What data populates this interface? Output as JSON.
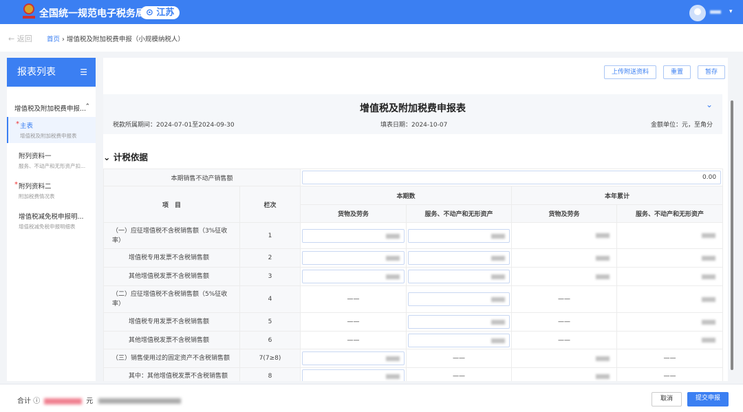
{
  "header": {
    "site_title": "全国统一规范电子税务局",
    "region": "江苏"
  },
  "breadcrumb": {
    "back": "返回",
    "home": "首页",
    "current": "增值税及附加税费申报（小规模纳税人）"
  },
  "sidebar": {
    "title": "报表列表",
    "group": "增值税及附加税费申报...",
    "items": [
      {
        "title": "主表",
        "subtitle": "增值税及附加税费申报表",
        "required": true,
        "active": true
      },
      {
        "title": "附列资料一",
        "subtitle": "服务、不动产和无形资产扣...",
        "required": false,
        "active": false
      },
      {
        "title": "附列资料二",
        "subtitle": "附加税费情况表",
        "required": true,
        "active": false
      },
      {
        "title": "增值税减免税申报明...",
        "subtitle": "增值税减免税申报明细表",
        "required": false,
        "active": false
      }
    ]
  },
  "toolbar": {
    "upload": "上传附送资料",
    "reset": "重置",
    "save": "暂存"
  },
  "form": {
    "title": "增值税及附加税费申报表",
    "period": "税款所属期间：2024-07-01至2024-09-30",
    "fill_date": "填表日期：2024-10-07",
    "unit": "金额单位：元，至角分"
  },
  "section": "计税依据",
  "table": {
    "realestate_label": "本期销售不动产销售额",
    "realestate_value": "0.00",
    "headers": {
      "item": "项　目",
      "line": "栏次",
      "current": "本期数",
      "ytd": "本年累计",
      "goods": "货物及劳务",
      "services": "服务、不动产和无形资产"
    },
    "dash": "——",
    "rows": [
      {
        "label": "（一）应征增值税不含税销售额（3%征收率）",
        "line": "1",
        "indent": false,
        "cells": [
          "input",
          "input",
          "value",
          "value"
        ]
      },
      {
        "label": "增值税专用发票不含税销售额",
        "line": "2",
        "indent": true,
        "cells": [
          "input",
          "input",
          "value",
          "value"
        ]
      },
      {
        "label": "其他增值税发票不含税销售额",
        "line": "3",
        "indent": true,
        "cells": [
          "input",
          "input",
          "value",
          "value"
        ]
      },
      {
        "label": "（二）应征增值税不含税销售额（5%征收率）",
        "line": "4",
        "indent": false,
        "cells": [
          "dash",
          "input",
          "dash",
          "value"
        ]
      },
      {
        "label": "增值税专用发票不含税销售额",
        "line": "5",
        "indent": true,
        "cells": [
          "dash",
          "input",
          "dash",
          "value"
        ]
      },
      {
        "label": "其他增值税发票不含税销售额",
        "line": "6",
        "indent": true,
        "cells": [
          "dash",
          "input",
          "dash",
          "value"
        ]
      },
      {
        "label": "（三）销售使用过的固定资产不含税销售额",
        "line": "7(7≥8)",
        "indent": false,
        "cells": [
          "input",
          "dash",
          "value",
          "dash"
        ]
      },
      {
        "label": "其中：其他增值税发票不含税销售额",
        "line": "8",
        "indent": true,
        "cells": [
          "input",
          "dash",
          "value",
          "dash"
        ]
      }
    ]
  },
  "footer": {
    "total_label": "合计",
    "currency": "元",
    "cancel": "取消",
    "submit": "提交申报"
  },
  "colors": {
    "brand": "#3b7ff2",
    "required": "#e33"
  }
}
